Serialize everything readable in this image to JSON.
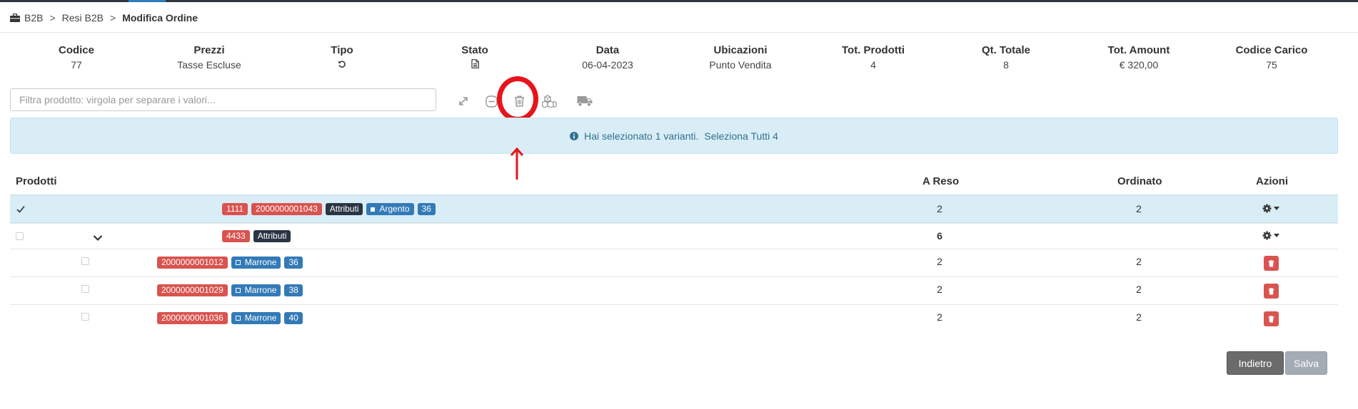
{
  "breadcrumb": {
    "items": [
      "B2B",
      "Resi B2B"
    ],
    "separator": ">",
    "current": "Modifica Ordine"
  },
  "summary": [
    {
      "label": "Codice",
      "value": "77"
    },
    {
      "label": "Prezzi",
      "value": "Tasse Escluse"
    },
    {
      "label": "Tipo",
      "value": "",
      "icon": "undo-icon"
    },
    {
      "label": "Stato",
      "value": "",
      "icon": "document-icon"
    },
    {
      "label": "Data",
      "value": "06-04-2023"
    },
    {
      "label": "Ubicazioni",
      "value": "Punto Vendita"
    },
    {
      "label": "Tot. Prodotti",
      "value": "4"
    },
    {
      "label": "Qt. Totale",
      "value": "8"
    },
    {
      "label": "Tot. Amount",
      "value": "€ 320,00"
    },
    {
      "label": "Codice Carico",
      "value": "75"
    }
  ],
  "filter": {
    "placeholder": "Filtra prodotto: virgola per separare i valori...",
    "value": ""
  },
  "toolbar": {
    "icons": [
      "expand-icon",
      "collapse-minus-icon",
      "trash-icon",
      "cubes-icon",
      "truck-icon"
    ]
  },
  "alert": {
    "text": "Hai selezionato 1 varianti.",
    "select_all": "Seleziona Tutti 4"
  },
  "table": {
    "headers": {
      "products": "Prodotti",
      "returned": "A Reso",
      "ordered": "Ordinato",
      "actions": "Azioni"
    },
    "rows": [
      {
        "code": "1111",
        "barcode": "2000000001043",
        "attributes": "Attributi",
        "color": "Argento",
        "size": "36",
        "returned": "2",
        "ordered": "2",
        "selected": true
      },
      {
        "code": "4433",
        "attributes": "Attributi",
        "returned": "6",
        "ordered": "",
        "expanded": true
      },
      {
        "barcode": "2000000001012",
        "color": "Marrone",
        "size": "36",
        "returned": "2",
        "ordered": "2"
      },
      {
        "barcode": "2000000001029",
        "color": "Marrone",
        "size": "38",
        "returned": "2",
        "ordered": "2"
      },
      {
        "barcode": "2000000001036",
        "color": "Marrone",
        "size": "40",
        "returned": "2",
        "ordered": "2"
      }
    ]
  },
  "buttons": {
    "back": "Indietro",
    "save": "Salva"
  },
  "colors": {
    "tag_red": "#d9534f",
    "tag_dark": "#2a3544",
    "tag_blue": "#337ab7",
    "alert_bg": "#d9edf7",
    "highlight": "#e8141b"
  }
}
